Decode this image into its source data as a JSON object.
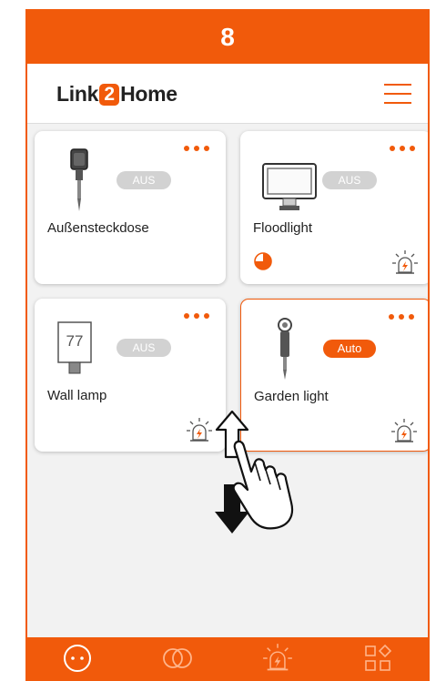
{
  "step": {
    "number": "8"
  },
  "header": {
    "logo": {
      "prefix": "Link",
      "two": "2",
      "suffix": "Home"
    },
    "menu_icon": "hamburger-menu-icon"
  },
  "devices": [
    {
      "label": "Außensteckdose",
      "status": "AUS",
      "icon": "outdoor-socket-icon",
      "active": false
    },
    {
      "label": "Floodlight",
      "status": "AUS",
      "icon": "floodlight-icon",
      "active": false,
      "extras": [
        "timer-icon",
        "siren-icon"
      ]
    },
    {
      "label": "Wall lamp",
      "status": "AUS",
      "icon": "wall-lamp-icon",
      "icon_text": "77",
      "active": false,
      "extras": [
        "siren-icon"
      ]
    },
    {
      "label": "Garden light",
      "status": "Auto",
      "icon": "garden-light-icon",
      "active": true,
      "extras": [
        "siren-icon"
      ]
    }
  ],
  "tabs": [
    "devices-tab-icon",
    "groups-tab-icon",
    "alarm-tab-icon",
    "apps-tab-icon"
  ],
  "colors": {
    "accent": "#f15a0b",
    "badge_off": "#d2d2d2",
    "background": "#f2f2f2"
  },
  "gesture": "drag-reorder-gesture-icon"
}
